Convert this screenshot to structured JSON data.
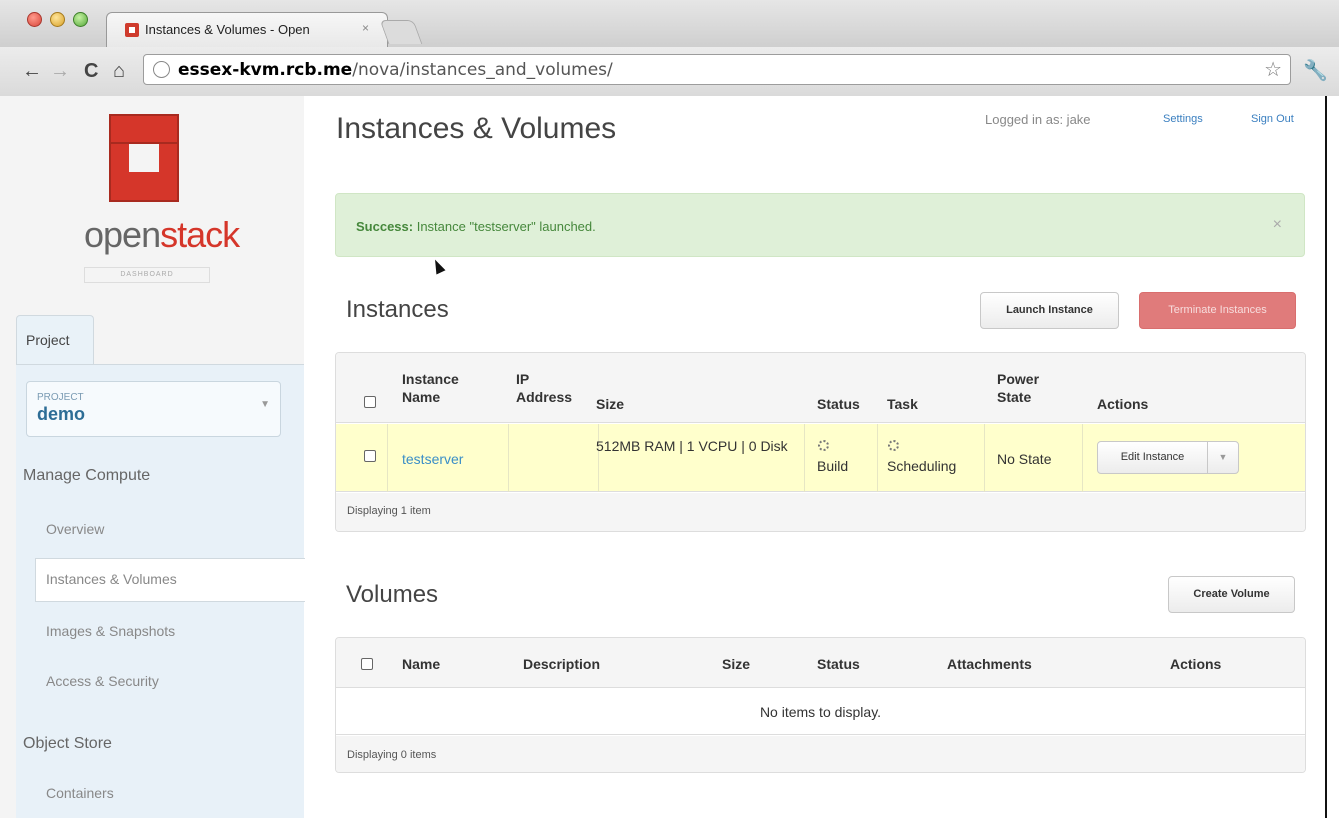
{
  "browser": {
    "tab_title": "Instances & Volumes - Open",
    "tab_close": "×",
    "url_host": "essex-kvm.rcb.me",
    "url_path": "/nova/instances_and_volumes/",
    "icons": [
      "back-icon",
      "forward-icon",
      "reload-icon",
      "home-icon",
      "globe-icon",
      "star-icon",
      "wrench-icon"
    ],
    "glyphs": {
      "back": "←",
      "forward": "→",
      "reload": "C",
      "home": "⌂",
      "star": "☆",
      "wrench": "🔧"
    }
  },
  "sidebar": {
    "logo_word_open": "open",
    "logo_word_stack": "stack",
    "logo_sub": "DASHBOARD",
    "tab": "Project",
    "project_label": "PROJECT",
    "project_value": "demo",
    "sections": [
      {
        "heading": "Manage Compute",
        "items": [
          "Overview",
          "Instances & Volumes",
          "Images & Snapshots",
          "Access & Security"
        ]
      },
      {
        "heading": "Object Store",
        "items": [
          "Containers"
        ]
      }
    ],
    "active_item": "Instances & Volumes"
  },
  "header": {
    "title": "Instances & Volumes",
    "logged_in": "Logged in as: jake",
    "settings": "Settings",
    "sign_out": "Sign Out"
  },
  "alert": {
    "strong": "Success:",
    "message": " Instance \"testserver\" launched.",
    "close": "×"
  },
  "instances": {
    "title": "Instances",
    "launch_button": "Launch Instance",
    "terminate_button": "Terminate Instances",
    "columns": [
      "Instance Name",
      "IP Address",
      "Size",
      "Status",
      "Task",
      "Power State",
      "Actions"
    ],
    "rows": [
      {
        "name": "testserver",
        "ip": "",
        "size": "512MB RAM | 1 VCPU | 0 Disk",
        "status": "Build",
        "task": "Scheduling",
        "power_state": "No State",
        "action": "Edit Instance"
      }
    ],
    "footer": "Displaying 1 item"
  },
  "volumes": {
    "title": "Volumes",
    "create_button": "Create Volume",
    "columns": [
      "Name",
      "Description",
      "Size",
      "Status",
      "Attachments",
      "Actions"
    ],
    "empty": "No items to display.",
    "footer": "Displaying 0 items"
  },
  "colors": {
    "accent": "#3a7fc0",
    "brand": "#d5362a",
    "success_bg": "#dff0d8",
    "row_highlight": "#ffffcc",
    "danger": "#e07b7b"
  }
}
